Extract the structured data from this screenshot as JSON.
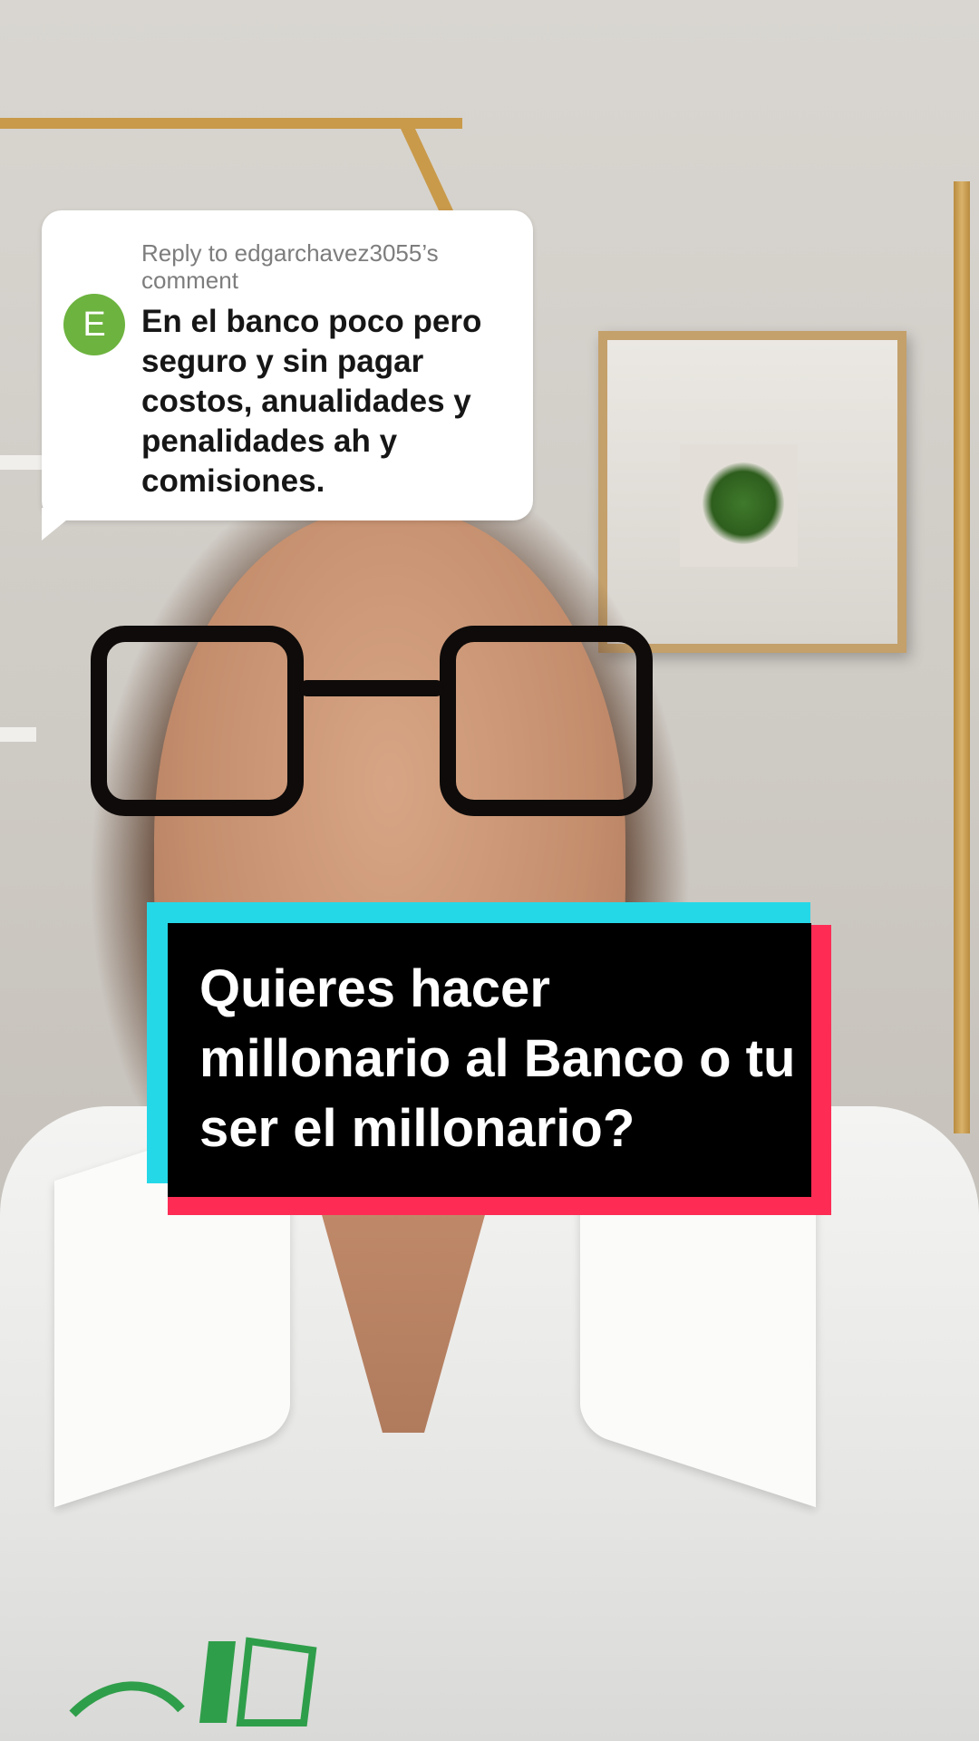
{
  "reply": {
    "header": "Reply to edgarchavez3055’s comment",
    "avatar_letter": "E",
    "avatar_color": "#6db33f",
    "comment": "En el banco poco pero seguro y sin pagar costos, anualidades y penalidades ah y comisiones."
  },
  "caption": {
    "text": "Quieres hacer millonario al Banco o tu ser el millonario?",
    "colors": {
      "background": "#000000",
      "accent_cyan": "#25d8e8",
      "accent_red": "#fe2c55",
      "text": "#ffffff"
    }
  }
}
